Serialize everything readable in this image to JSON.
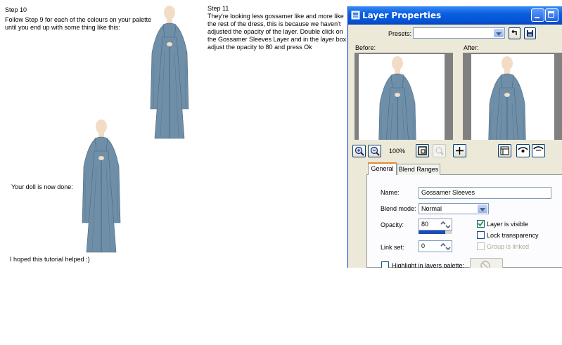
{
  "left": {
    "step10_title": "Step 10",
    "step10_line1": "Follow Step 9 for each of the colours on your palette",
    "step10_line2": "until you end up with some thing like this:",
    "done_text": "Your doll is now done:",
    "helped_text": "I hoped this tutorial helped :)"
  },
  "middle": {
    "step11_title": "Step 11",
    "step11_lines": [
      "They're looking less gossamer like and more like",
      "the rest of the dress, this is because we haven't",
      "adjusted the opacity of the layer. Double click on",
      "the Gossamer Sleeves Layer and in the layer box",
      "adjust the opacity to 80 and press Ok"
    ]
  },
  "dialog": {
    "title": "Layer Properties",
    "presets_label": "Presets:",
    "presets_value": "",
    "before_label": "Before:",
    "after_label": "After:",
    "zoom_level": "100%",
    "tabs": [
      "General",
      "Blend Ranges"
    ],
    "name_label": "Name:",
    "name_value": "Gossamer Sleeves",
    "blend_mode_label": "Blend mode:",
    "blend_mode_value": "Normal",
    "opacity_label": "Opacity:",
    "opacity_value": "80",
    "opacity_fraction": 0.8,
    "link_set_label": "Link set:",
    "link_set_value": "0",
    "layer_visible_label": "Layer is visible",
    "layer_visible_checked": true,
    "lock_transparency_label": "Lock transparency",
    "group_linked_label": "Group is linked",
    "highlight_label": "Highlight in layers palette:"
  },
  "colors": {
    "dress": "#6f8fa8",
    "dress_dark": "#4a6780",
    "skin": "#f3dcc6",
    "titlebar": "#0a5fe0",
    "dialog_bg": "#ece9d8"
  }
}
